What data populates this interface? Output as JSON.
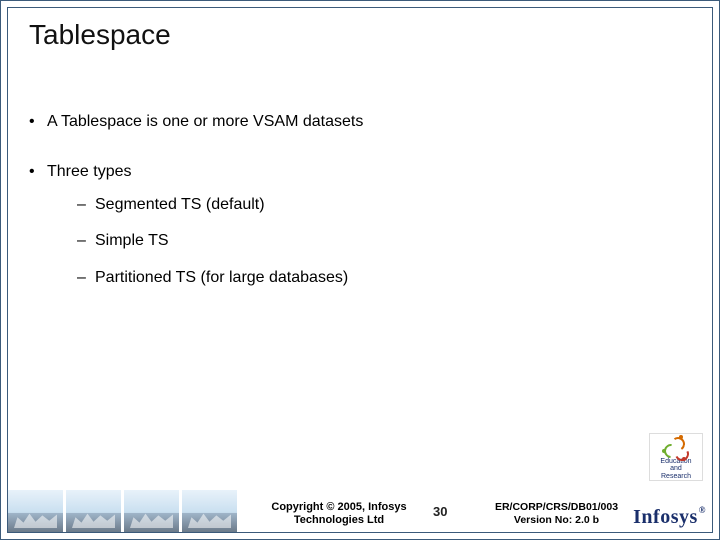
{
  "title": "Tablespace",
  "bullets": {
    "b1": "A Tablespace is one or more VSAM datasets",
    "b2": "Three types",
    "sub1": "Segmented TS (default)",
    "sub2": "Simple TS",
    "sub3": "Partitioned TS (for large databases)"
  },
  "footer": {
    "copyright_line1": "Copyright © 2005, Infosys",
    "copyright_line2": "Technologies Ltd",
    "slide_number": "30",
    "doc_id_line1": "ER/CORP/CRS/DB01/003",
    "doc_id_line2": "Version No: 2.0 b",
    "edu_logo_line1": "Education",
    "edu_logo_line2": "and",
    "edu_logo_line3": "Research",
    "infosys_logo": "Infosys"
  },
  "glyphs": {
    "bullet": "•",
    "dash": "–",
    "reg": "®"
  }
}
